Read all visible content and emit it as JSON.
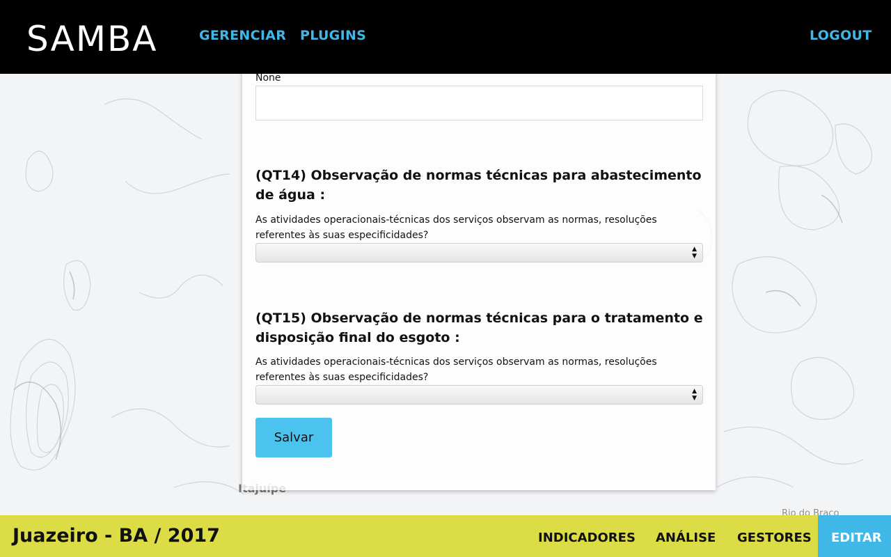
{
  "header": {
    "logo": "SAMBA",
    "nav": [
      "GERENCIAR",
      "PLUGINS"
    ],
    "logout": "LOGOUT"
  },
  "map": {
    "labels": [
      "Itajuípe",
      "Rio do Braço"
    ]
  },
  "form": {
    "prev_field_label": "None",
    "prev_field_value": "",
    "questions": [
      {
        "title": "(QT14) Observação de normas técnicas para abastecimento de água :",
        "description": "As atividades operacionais-técnicas dos serviços observam as normas, resoluções referentes às suas especificidades?",
        "selected": ""
      },
      {
        "title": "(QT15) Observação de normas técnicas para o tratamento e disposição final do esgoto :",
        "description": "As atividades operacionais-técnicas dos serviços observam as normas, resoluções referentes às suas especificidades?",
        "selected": ""
      }
    ],
    "save_label": "Salvar"
  },
  "footer": {
    "place": "Juazeiro - BA / 2017",
    "links": [
      "INDICADORES",
      "ANÁLISE",
      "GESTORES"
    ],
    "edit": "EDITAR"
  },
  "colors": {
    "accent_blue": "#3fb8e8",
    "button_blue": "#4cc3ee",
    "footer_yellow": "#dbdc46",
    "header_black": "#000000"
  }
}
